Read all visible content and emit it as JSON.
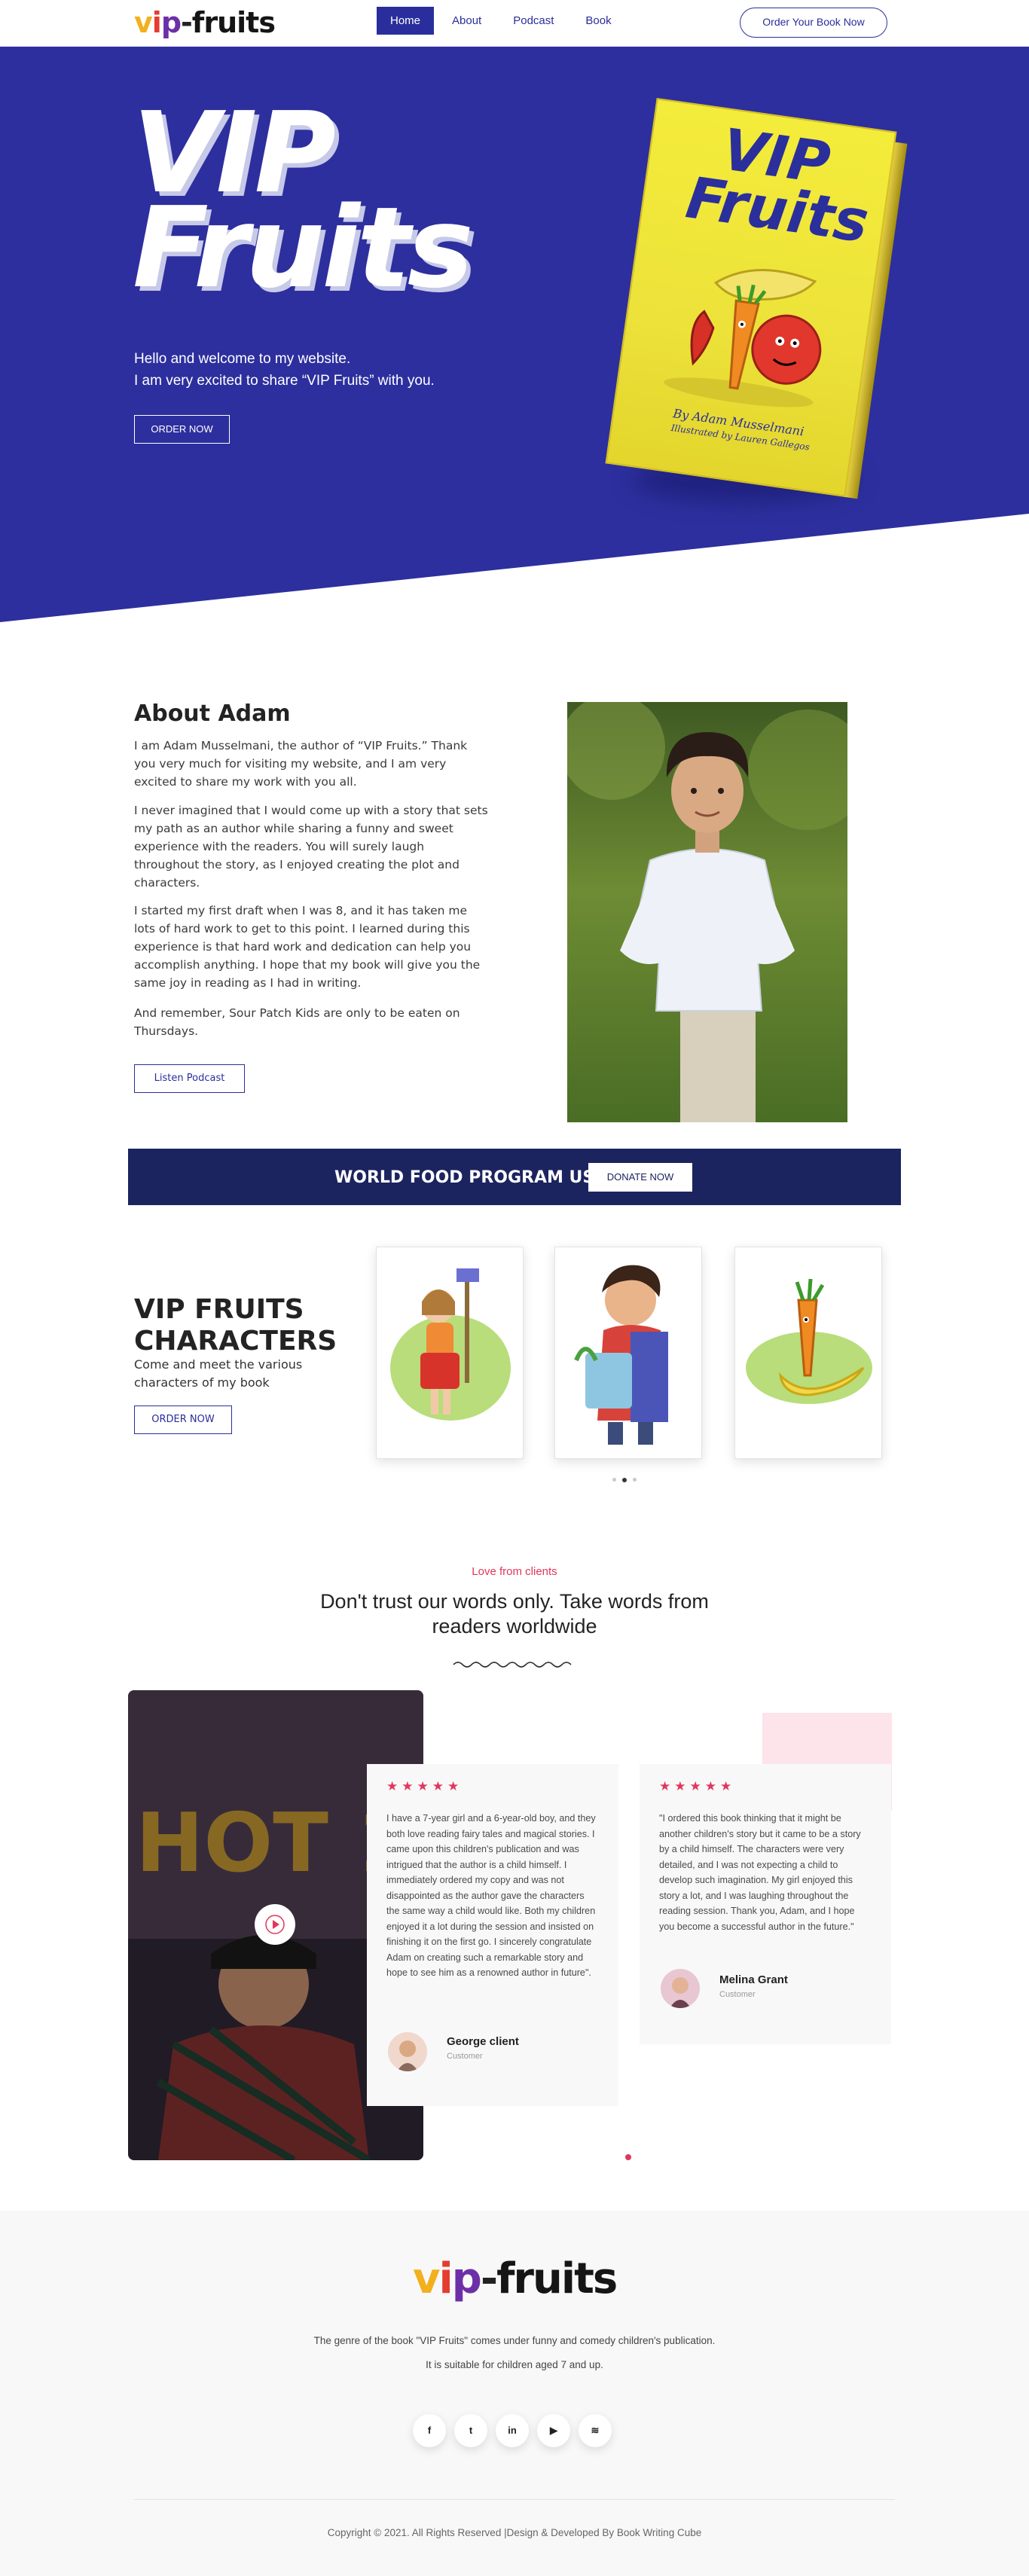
{
  "nav": {
    "logo": {
      "v": "v",
      "i": "i",
      "p": "p",
      "dash": "-",
      "fruits": "fruits"
    },
    "items": [
      {
        "label": "Home",
        "active": true
      },
      {
        "label": "About",
        "active": false
      },
      {
        "label": "Podcast",
        "active": false
      },
      {
        "label": "Book",
        "active": false
      }
    ],
    "cta": "Order Your Book Now"
  },
  "hero": {
    "title_line1": "VIP",
    "title_line2": "Fruits",
    "line1": "Hello and welcome to my website.",
    "line2": "I am very excited to share “VIP Fruits” with you.",
    "button": "ORDER NOW",
    "book": {
      "title_line1": "VIP",
      "title_line2": "Fruits",
      "author": "By Adam Musselmani",
      "illustrator": "Illustrated by Lauren Gallegos"
    },
    "bg_color": "#2d2f9e"
  },
  "about": {
    "heading": "About Adam",
    "p1": "I am Adam Musselmani, the author of “VIP Fruits.” Thank you very much for visiting my website, and I am very excited to share my work with you all.",
    "p2": "I never imagined that I would come up with a story that sets my path as an author while sharing a funny and sweet experience with the readers. You will surely laugh throughout the story, as I enjoyed creating the plot and characters.",
    "p3": "I started my first draft when I was 8, and it has taken me lots of hard work to get to this point. I learned during this experience is that hard work and dedication can help you accomplish anything. I hope that my book will give you the same joy in reading as I had in writing.",
    "p4": "And remember, Sour Patch Kids are only to be eaten on Thursdays.",
    "button": "Listen Podcast"
  },
  "donate": {
    "title": "WORLD FOOD PROGRAM USA",
    "button": "DONATE NOW",
    "bg_color": "#1c2460"
  },
  "characters": {
    "heading_line1": "VIP FRUITS",
    "heading_line2": "CHARACTERS",
    "subtitle": "Come and meet the various characters of my book",
    "button": "ORDER NOW",
    "cards": [
      "girl-cleaning-character",
      "boy-with-bag-character",
      "carrot-banana-character"
    ],
    "active_dot": 2
  },
  "testimonials": {
    "eyebrow": "Love from clients",
    "heading": "Don't trust our words only. Take words from readers worldwide",
    "video_caption": "HOT 1",
    "accent_color": "#e2365c",
    "items": [
      {
        "stars": "★★★★★",
        "text": "I have a 7-year girl and a 6-year-old boy, and they both love reading fairy tales and magical stories. I came upon this children's publication and was intrigued that the author is a child himself. I immediately ordered my copy and was not disappointed as the author gave the characters the same way a child would like. Both my children enjoyed it a lot during the session and insisted on finishing it on the first go. I sincerely congratulate Adam on creating such a remarkable story and hope to see him as a renowned author in future\".",
        "name": "George client",
        "role": "Customer"
      },
      {
        "stars": "★★★★★",
        "text": "\"I ordered this book thinking that it might be another children's story but it came to be a story by a child himself. The characters were very detailed, and I was not expecting a child to develop such imagination. My girl enjoyed this story a lot, and I was laughing throughout the reading session. Thank you, Adam, and I hope you become a successful author in the future.\"",
        "name": "Melina Grant",
        "role": "Customer"
      }
    ]
  },
  "footer": {
    "logo": {
      "v": "v",
      "i": "i",
      "p": "p",
      "dash": "-",
      "fruits": "fruits"
    },
    "line1": "The genre of the book \"VIP Fruits\" comes under funny and comedy children's publication.",
    "line2": "It is suitable for children aged 7 and up.",
    "socials": [
      {
        "icon": "facebook-icon",
        "glyph": "f"
      },
      {
        "icon": "twitter-icon",
        "glyph": "t"
      },
      {
        "icon": "linkedin-icon",
        "glyph": "in"
      },
      {
        "icon": "youtube-icon",
        "glyph": "▶"
      },
      {
        "icon": "spotify-icon",
        "glyph": "≋"
      }
    ],
    "copyright": "Copyright © 2021. All Rights Reserved |Design & Developed By Book Writing Cube"
  }
}
